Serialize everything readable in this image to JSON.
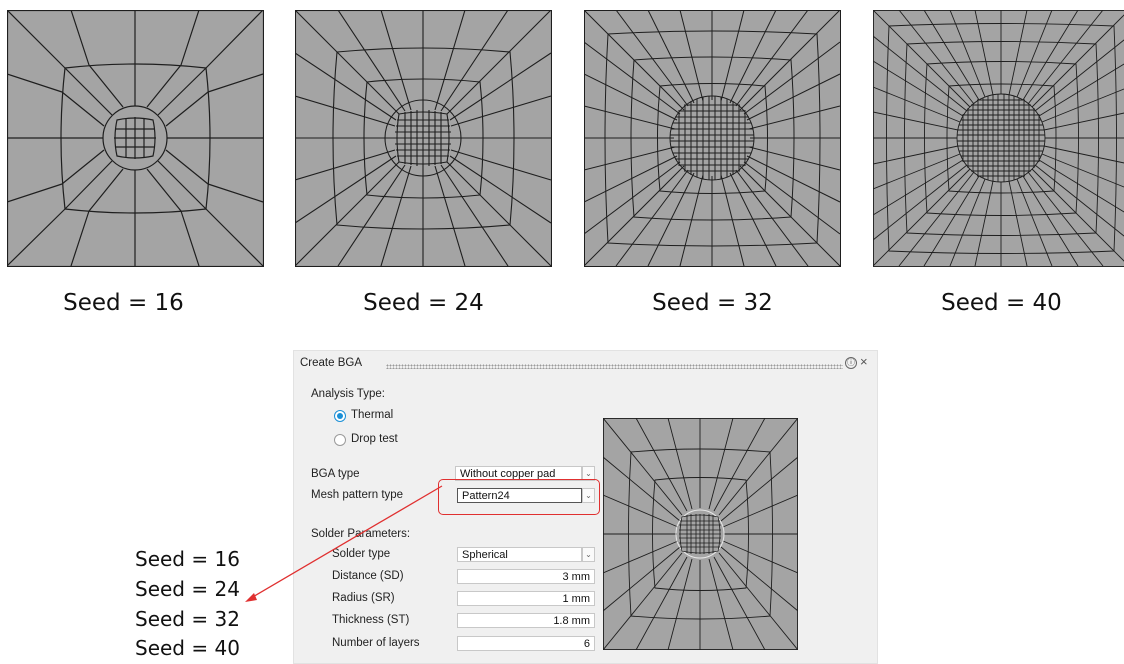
{
  "captions": [
    "Seed = 16",
    "Seed = 24",
    "Seed = 32",
    "Seed = 40"
  ],
  "dialog": {
    "title": "Create BGA",
    "help_icon": "ⓘ",
    "close_icon": "×",
    "analysis_type": {
      "label": "Analysis Type:",
      "options": [
        "Thermal",
        "Drop test"
      ],
      "selected": "Thermal"
    },
    "bga_type": {
      "label": "BGA type",
      "value": "Without copper pad"
    },
    "mesh_pattern": {
      "label": "Mesh pattern type",
      "value": "Pattern24"
    },
    "solder": {
      "heading": "Solder Parameters:",
      "type": {
        "label": "Solder type",
        "value": "Spherical"
      },
      "distance": {
        "label": "Distance (SD)",
        "value": "3 mm"
      },
      "radius": {
        "label": "Radius (SR)",
        "value": "1 mm"
      },
      "thickness": {
        "label": "Thickness (ST)",
        "value": "1.8 mm"
      },
      "layers": {
        "label": "Number of layers",
        "value": "6"
      }
    }
  },
  "seed_options": [
    "Seed = 16",
    "Seed = 24",
    "Seed = 32",
    "Seed = 40"
  ],
  "colors": {
    "mesh_fill": "#a4a4a4",
    "mesh_line": "#1e1e1e",
    "highlight": "#e03030",
    "radio_on": "#1a8fd6"
  }
}
